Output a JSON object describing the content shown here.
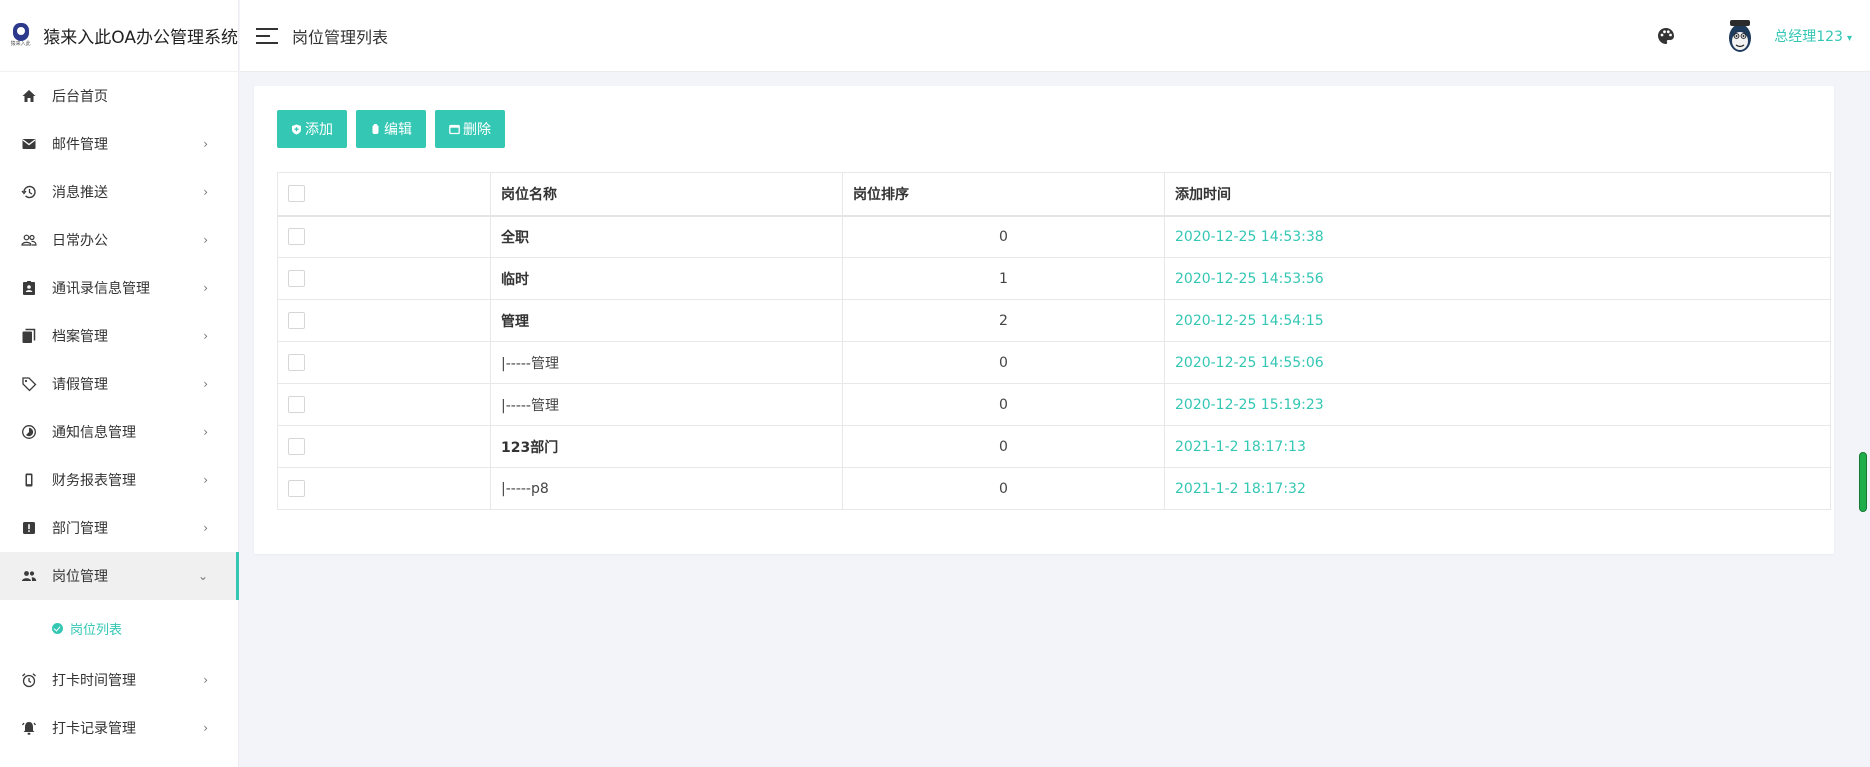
{
  "app": {
    "title": "猿来入此OA办公管理系统",
    "logo_text": "猿来入此"
  },
  "sidebar": {
    "items": [
      {
        "label": "后台首页",
        "icon": "home-icon",
        "has_children": false
      },
      {
        "label": "邮件管理",
        "icon": "mail-icon",
        "has_children": true
      },
      {
        "label": "消息推送",
        "icon": "history-icon",
        "has_children": true
      },
      {
        "label": "日常办公",
        "icon": "people-outline-icon",
        "has_children": true
      },
      {
        "label": "通讯录信息管理",
        "icon": "contact-card-icon",
        "has_children": true
      },
      {
        "label": "档案管理",
        "icon": "document-icon",
        "has_children": true
      },
      {
        "label": "请假管理",
        "icon": "tag-icon",
        "has_children": true
      },
      {
        "label": "通知信息管理",
        "icon": "timelapse-icon",
        "has_children": true
      },
      {
        "label": "财务报表管理",
        "icon": "phone-icon",
        "has_children": true
      },
      {
        "label": "部门管理",
        "icon": "alert-box-icon",
        "has_children": true
      },
      {
        "label": "岗位管理",
        "icon": "people-icon",
        "has_children": true,
        "expanded": true
      },
      {
        "label": "打卡时间管理",
        "icon": "alarm-icon",
        "has_children": true
      },
      {
        "label": "打卡记录管理",
        "icon": "bell-icon",
        "has_children": true
      }
    ],
    "submenu_active": "岗位列表",
    "arrow_collapsed": "›",
    "arrow_expanded": "⌄"
  },
  "header": {
    "page_title": "岗位管理列表",
    "user_name": "总经理123",
    "caret": "▾"
  },
  "toolbar": {
    "add_label": "添加",
    "edit_label": "编辑",
    "delete_label": "删除"
  },
  "table": {
    "columns": [
      "岗位名称",
      "岗位排序",
      "添加时间"
    ],
    "rows": [
      {
        "name": "全职",
        "sort": "0",
        "time": "2020-12-25 14:53:38",
        "bold": true
      },
      {
        "name": "临时",
        "sort": "1",
        "time": "2020-12-25 14:53:56",
        "bold": true
      },
      {
        "name": "管理",
        "sort": "2",
        "time": "2020-12-25 14:54:15",
        "bold": true
      },
      {
        "name": "|-----管理",
        "sort": "0",
        "time": "2020-12-25 14:55:06",
        "bold": false
      },
      {
        "name": "|-----管理",
        "sort": "0",
        "time": "2020-12-25 15:19:23",
        "bold": false
      },
      {
        "name": "123部门",
        "sort": "0",
        "time": "2021-1-2 18:17:13",
        "bold": true
      },
      {
        "name": "|-----p8",
        "sort": "0",
        "time": "2021-1-2 18:17:32",
        "bold": false
      }
    ]
  },
  "colors": {
    "accent": "#34c7b4",
    "background": "#f3f4f9"
  }
}
